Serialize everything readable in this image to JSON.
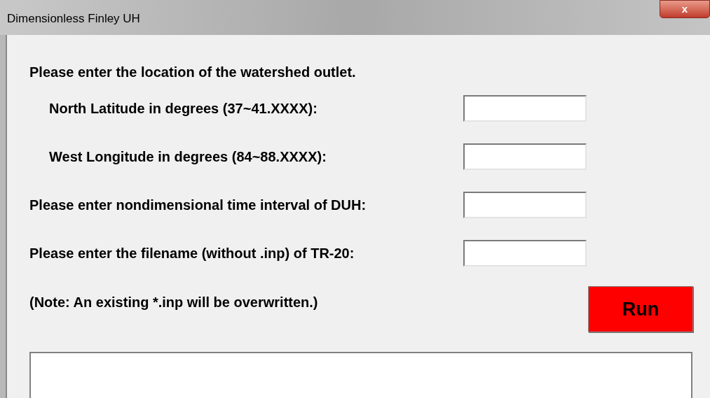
{
  "window": {
    "title": "Dimensionless Finley UH",
    "close_button": "x"
  },
  "location": {
    "prompt": "Please enter the location of the watershed outlet.",
    "fields": [
      {
        "label": "North Latitude in degrees (37~41.XXXX):"
      },
      {
        "label": "West Longitude in degrees (84~88.XXXX):"
      }
    ]
  },
  "fields": [
    {
      "label": "Please enter nondimensional time interval of DUH:"
    },
    {
      "label": "Please enter the filename (without .inp) of TR-20:"
    }
  ],
  "note": "(Note: An existing *.inp will be overwritten.)",
  "run_button": "Run"
}
